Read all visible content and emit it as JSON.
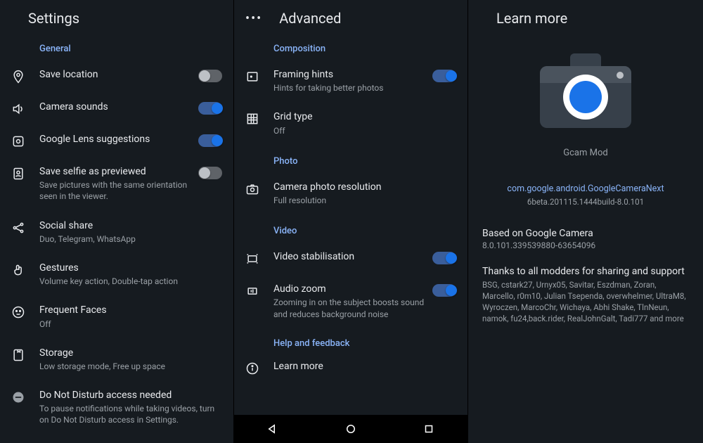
{
  "p1": {
    "title": "Settings",
    "section": "General",
    "items": [
      {
        "t": "Save location",
        "s": "",
        "toggle": "off"
      },
      {
        "t": "Camera sounds",
        "s": "",
        "toggle": "on"
      },
      {
        "t": "Google Lens suggestions",
        "s": "",
        "toggle": "on"
      },
      {
        "t": "Save selfie as previewed",
        "s": "Save pictures with the same orientation seen in the viewer.",
        "toggle": "off"
      },
      {
        "t": "Social share",
        "s": "Duo, Telegram, WhatsApp"
      },
      {
        "t": "Gestures",
        "s": "Volume key action, Double-tap action"
      },
      {
        "t": "Frequent Faces",
        "s": "Off"
      },
      {
        "t": "Storage",
        "s": "Low storage mode, Free up space"
      },
      {
        "t": "Do Not Disturb access needed",
        "s": "To pause notifications while taking videos, turn on Do Not Disturb access in Settings."
      }
    ]
  },
  "p2": {
    "title": "Advanced",
    "sec_comp": "Composition",
    "sec_photo": "Photo",
    "sec_video": "Video",
    "sec_help": "Help and feedback",
    "framing_t": "Framing hints",
    "framing_s": "Hints for taking better photos",
    "grid_t": "Grid type",
    "grid_s": "Off",
    "res_t": "Camera photo resolution",
    "res_s": "Full resolution",
    "stab_t": "Video stabilisation",
    "audio_t": "Audio zoom",
    "audio_s": "Zooming in on the subject boosts sound and reduces background noise",
    "learn_t": "Learn more"
  },
  "p3": {
    "title": "Learn more",
    "appname": "Gcam Mod",
    "pkg": "com.google.android.GoogleCameraNext",
    "build": "6beta.201115.1444build-8.0.101",
    "based_t": "Based on Google Camera",
    "based_s": "8.0.101.339539880-63654096",
    "thanks_t": "Thanks to all modders for sharing and support",
    "thanks_s": "BSG, cstark27, Urnyx05, Savitar, Eszdman, Zoran, Marcello, r0m10, Julian Tsependa, overwhelmer, UltraM8, Wyroczen, MarcoChr, Wichaya, Abhi Shake, TlnNeun, namok, fu24,back.rider, RealJohnGalt, Tadi777 and more"
  }
}
